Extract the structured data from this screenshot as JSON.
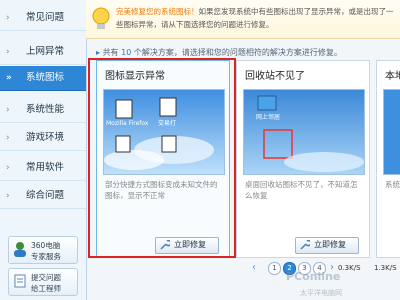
{
  "sidebar": {
    "items": [
      {
        "label": "常见问题"
      },
      {
        "label": "上网异常"
      },
      {
        "label": "系统图标"
      },
      {
        "label": "系统性能"
      },
      {
        "label": "游戏环境"
      },
      {
        "label": "常用软件"
      },
      {
        "label": "综合问题"
      }
    ],
    "active_index": 2,
    "services": [
      {
        "line1": "360电脑",
        "line2": "专家服务"
      },
      {
        "line1": "提交问题",
        "line2": "给工程师"
      }
    ]
  },
  "banner": {
    "line1_prefix": "完美修复您的系统图标！",
    "line1_rest": "如果您发现系统中有些图标出现了显示异常，或是出现了一",
    "line2": "些图标异常，请从下面选择您的问题进行修复。"
  },
  "count_line": {
    "prefix": "共有",
    "count": "10",
    "suffix": "个解决方案，请选择和您的问题相符的解决方案进行修复。"
  },
  "cards": [
    {
      "title": "图标显示异常",
      "desc": "部分快捷方式图标变成未知文件的图标，显示不正常",
      "button": "立即修复",
      "icons": [
        {
          "label": "Mozilla Firefox"
        },
        {
          "label": "交易打"
        },
        {
          "label": ""
        },
        {
          "label": ""
        }
      ]
    },
    {
      "title": "回收站不见了",
      "desc": "桌面回收站图标不见了，不知道怎么恢复",
      "button": "立即修复",
      "icons": [
        {
          "label": "网上邻居"
        }
      ]
    },
    {
      "title": "本地",
      "desc": "系统",
      "button": "立"
    }
  ],
  "pager": {
    "pages": [
      "1",
      "2",
      "3",
      "4"
    ],
    "active": "2"
  },
  "status": {
    "speed_up": "0.3K/S",
    "speed_down": "1.3K/S"
  },
  "watermark": {
    "main": "PConline",
    "sub": "太平洋电脑网"
  },
  "colors": {
    "accent": "#2e86d6",
    "highlight": "#f07a00",
    "selection_box": "#dd2222"
  }
}
